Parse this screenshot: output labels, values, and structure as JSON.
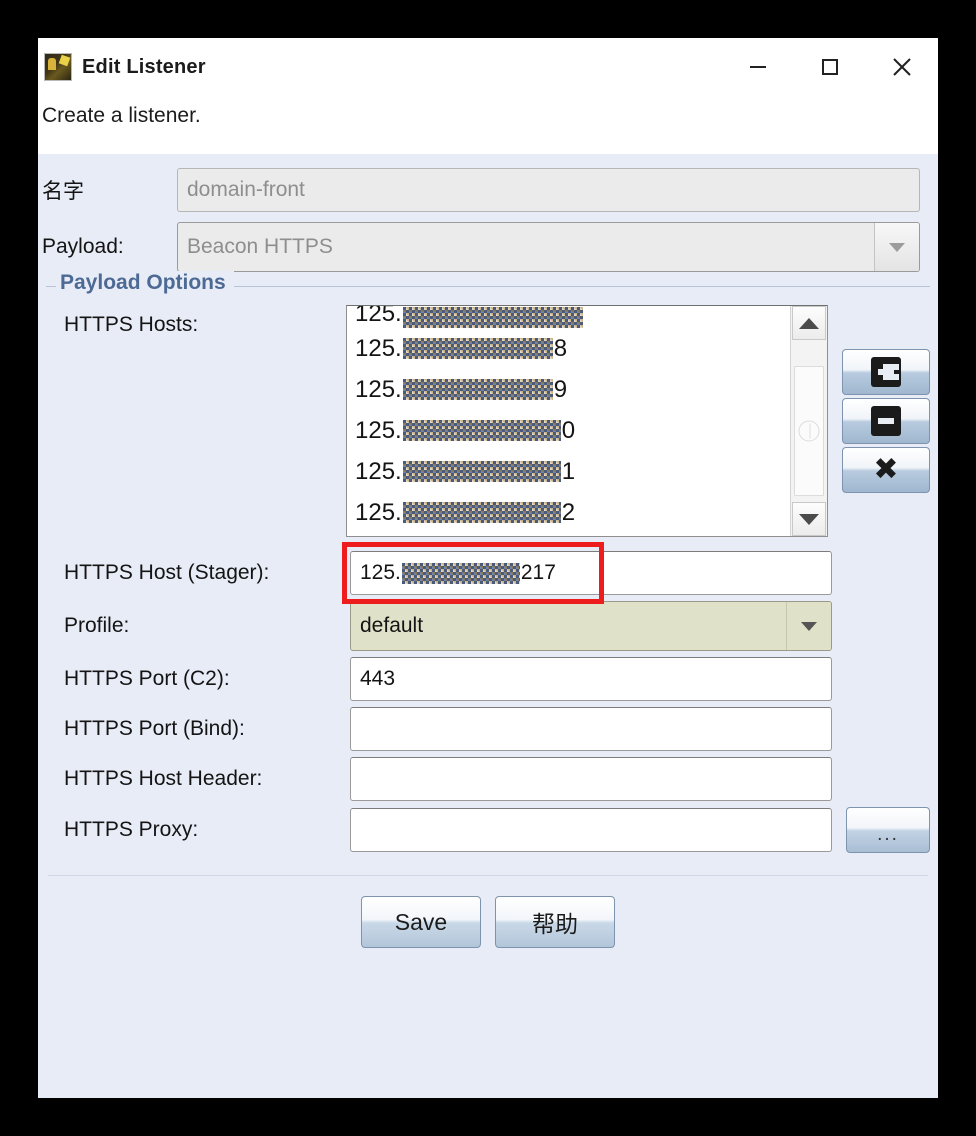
{
  "window": {
    "title": "Edit Listener",
    "icon": "app-icon",
    "minimize": "—",
    "maximize": "□",
    "close": "✕"
  },
  "header": {
    "description": "Create a listener."
  },
  "form": {
    "name_label": "名字",
    "name_value": "domain-front",
    "payload_label": "Payload:",
    "payload_value": "Beacon HTTPS"
  },
  "group": {
    "title": "Payload Options",
    "hosts_label": "HTTPS Hosts:",
    "hosts_items": [
      "125.██.1██.██",
      "125.██.1██.██8",
      "125.██.1██.██9",
      "125.██.1██.██0",
      "125.██.1██.██1",
      "125.██.1██.██2"
    ],
    "hosts_item_prefix": "125.",
    "add_button": "add-icon",
    "remove_button": "remove-icon",
    "clear_button": "clear-icon",
    "stager_label": "HTTPS Host (Stager):",
    "stager_value_prefix": "125.",
    "stager_value_suffix": "217",
    "stager_value": "125.██.1██.217",
    "profile_label": "Profile:",
    "profile_value": "default",
    "port_c2_label": "HTTPS Port (C2):",
    "port_c2_value": "443",
    "port_bind_label": "HTTPS Port (Bind):",
    "port_bind_value": "",
    "host_header_label": "HTTPS Host Header:",
    "host_header_value": "",
    "proxy_label": "HTTPS Proxy:",
    "proxy_value": "",
    "proxy_browse_label": "..."
  },
  "footer": {
    "save_label": "Save",
    "help_label": "帮助"
  },
  "colors": {
    "panel_bg": "#e8ecf7",
    "header_bg": "#ffffff",
    "group_title": "#4d6a94",
    "annotation": "#ee1d1d",
    "profile_field": "#dfe2c8"
  }
}
